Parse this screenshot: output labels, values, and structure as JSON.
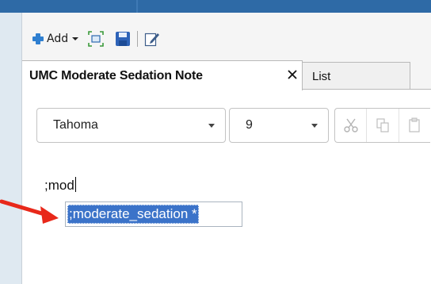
{
  "toolbar": {
    "add_label": "Add",
    "icons": [
      "add-plus-icon",
      "dropdown-caret-icon",
      "fit-view-icon",
      "save-disk-icon",
      "edit-note-icon"
    ]
  },
  "tabs": [
    {
      "label": "UMC Moderate Sedation Note",
      "active": true
    },
    {
      "label": "List",
      "active": false
    }
  ],
  "format_bar": {
    "font": "Tahoma",
    "size": "9",
    "icons": [
      "cut-icon",
      "copy-icon",
      "paste-icon"
    ]
  },
  "editor": {
    "typed_text": ";mod",
    "autocomplete_suggestion": ";moderate_sedation *"
  },
  "colors": {
    "title_bar": "#2e6aa6",
    "selection": "#3b73c9",
    "annotation_arrow": "#e8281a",
    "background": "#dfe9f1"
  }
}
